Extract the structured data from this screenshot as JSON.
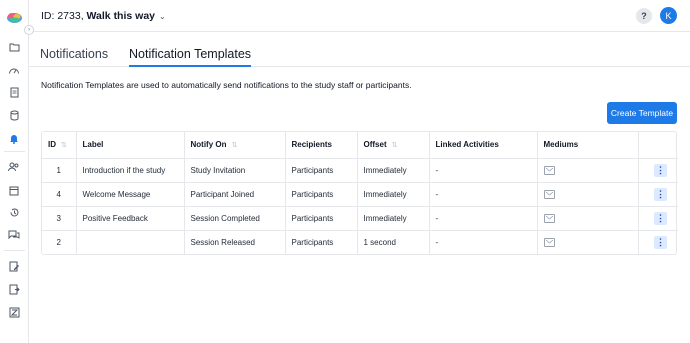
{
  "header": {
    "title_prefix": "ID: 2733, ",
    "title_name": "Walk this way",
    "help_label": "?",
    "avatar_initial": "K"
  },
  "tabs": [
    {
      "label": "Notifications",
      "active": false
    },
    {
      "label": "Notification Templates",
      "active": true
    }
  ],
  "description": "Notification Templates are used to automatically send notifications to the study staff or participants.",
  "create_button": "Create Template",
  "table": {
    "columns": [
      "ID",
      "Label",
      "Notify On",
      "Recipients",
      "Offset",
      "Linked Activities",
      "Mediums",
      ""
    ],
    "rows": [
      {
        "id": "1",
        "label": "Introduction if the study",
        "notify_on": "Study Invitation",
        "recipients": "Participants",
        "offset": "Immediately",
        "linked": "-"
      },
      {
        "id": "4",
        "label": "Welcome Message",
        "notify_on": "Participant Joined",
        "recipients": "Participants",
        "offset": "Immediately",
        "linked": "-"
      },
      {
        "id": "3",
        "label": "Positive Feedback",
        "notify_on": "Session Completed",
        "recipients": "Participants",
        "offset": "Immediately",
        "linked": "-"
      },
      {
        "id": "2",
        "label": "",
        "notify_on": "Session Released",
        "recipients": "Participants",
        "offset": "1 second",
        "linked": "-"
      }
    ]
  },
  "sidebar_icons": [
    "folder-icon",
    "dashboard-icon",
    "document-icon",
    "database-icon",
    "bell-icon",
    "users-icon",
    "calendar-icon",
    "history-icon",
    "chat-icon",
    "edit-document-icon",
    "export-document-icon",
    "zeta-icon"
  ],
  "colors": {
    "accent": "#1d7ae6",
    "border": "#e5e7eb"
  }
}
